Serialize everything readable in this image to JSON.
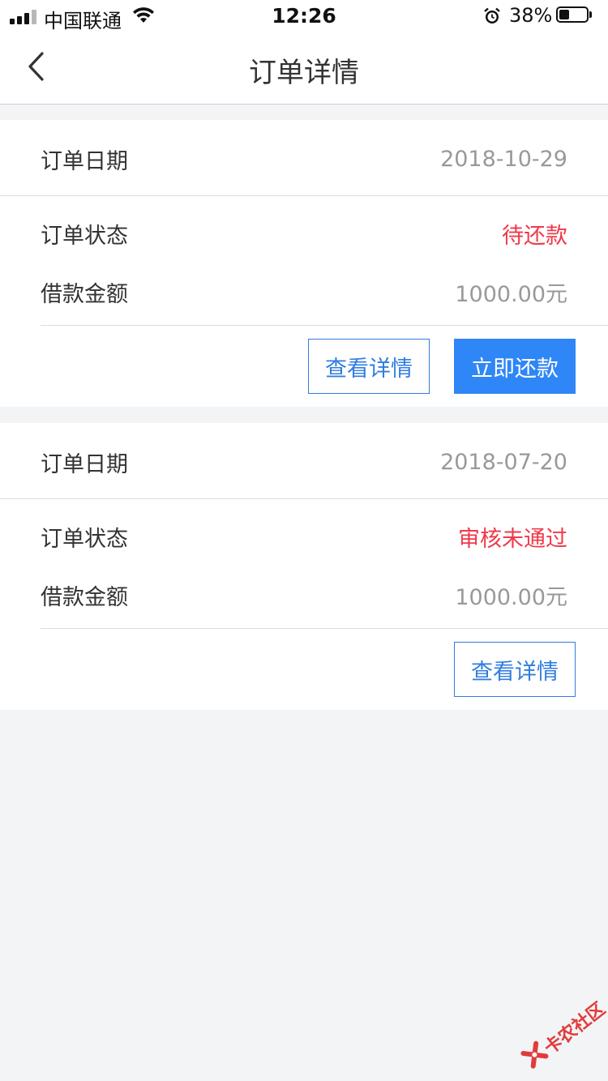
{
  "status_bar": {
    "carrier": "中国联通",
    "time": "12:26",
    "battery_percent_label": "38%",
    "battery_level": 0.38,
    "signal_bars": 4,
    "signal_active": 3
  },
  "nav": {
    "title": "订单详情",
    "back_icon": "chevron-left-icon"
  },
  "orders": [
    {
      "date_label": "订单日期",
      "date": "2018-10-29",
      "status_label": "订单状态",
      "status": "待还款",
      "amount_label": "借款金额",
      "amount": "1000.00元",
      "buttons": {
        "detail": "查看详情",
        "repay": "立即还款"
      }
    },
    {
      "date_label": "订单日期",
      "date": "2018-07-20",
      "status_label": "订单状态",
      "status": "审核未通过",
      "amount_label": "借款金额",
      "amount": "1000.00元",
      "buttons": {
        "detail": "查看详情"
      }
    }
  ],
  "watermark": {
    "text": "卡农社区"
  },
  "colors": {
    "accent_blue": "#2f86f6",
    "status_red": "#f0394a",
    "muted_gray": "#999999",
    "background": "#f3f4f6"
  }
}
